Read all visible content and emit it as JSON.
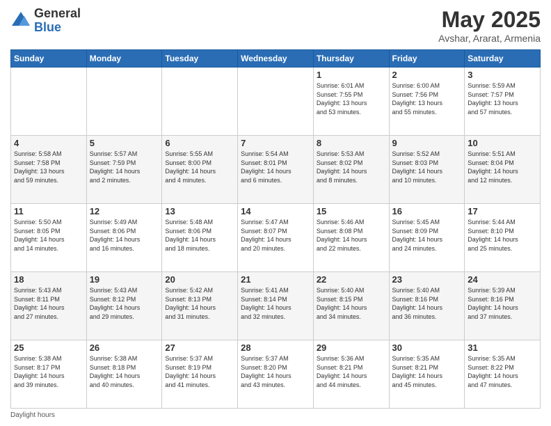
{
  "logo": {
    "general": "General",
    "blue": "Blue"
  },
  "title": "May 2025",
  "location": "Avshar, Ararat, Armenia",
  "days_of_week": [
    "Sunday",
    "Monday",
    "Tuesday",
    "Wednesday",
    "Thursday",
    "Friday",
    "Saturday"
  ],
  "weeks": [
    [
      {
        "day": "",
        "info": ""
      },
      {
        "day": "",
        "info": ""
      },
      {
        "day": "",
        "info": ""
      },
      {
        "day": "",
        "info": ""
      },
      {
        "day": "1",
        "info": "Sunrise: 6:01 AM\nSunset: 7:55 PM\nDaylight: 13 hours\nand 53 minutes."
      },
      {
        "day": "2",
        "info": "Sunrise: 6:00 AM\nSunset: 7:56 PM\nDaylight: 13 hours\nand 55 minutes."
      },
      {
        "day": "3",
        "info": "Sunrise: 5:59 AM\nSunset: 7:57 PM\nDaylight: 13 hours\nand 57 minutes."
      }
    ],
    [
      {
        "day": "4",
        "info": "Sunrise: 5:58 AM\nSunset: 7:58 PM\nDaylight: 13 hours\nand 59 minutes."
      },
      {
        "day": "5",
        "info": "Sunrise: 5:57 AM\nSunset: 7:59 PM\nDaylight: 14 hours\nand 2 minutes."
      },
      {
        "day": "6",
        "info": "Sunrise: 5:55 AM\nSunset: 8:00 PM\nDaylight: 14 hours\nand 4 minutes."
      },
      {
        "day": "7",
        "info": "Sunrise: 5:54 AM\nSunset: 8:01 PM\nDaylight: 14 hours\nand 6 minutes."
      },
      {
        "day": "8",
        "info": "Sunrise: 5:53 AM\nSunset: 8:02 PM\nDaylight: 14 hours\nand 8 minutes."
      },
      {
        "day": "9",
        "info": "Sunrise: 5:52 AM\nSunset: 8:03 PM\nDaylight: 14 hours\nand 10 minutes."
      },
      {
        "day": "10",
        "info": "Sunrise: 5:51 AM\nSunset: 8:04 PM\nDaylight: 14 hours\nand 12 minutes."
      }
    ],
    [
      {
        "day": "11",
        "info": "Sunrise: 5:50 AM\nSunset: 8:05 PM\nDaylight: 14 hours\nand 14 minutes."
      },
      {
        "day": "12",
        "info": "Sunrise: 5:49 AM\nSunset: 8:06 PM\nDaylight: 14 hours\nand 16 minutes."
      },
      {
        "day": "13",
        "info": "Sunrise: 5:48 AM\nSunset: 8:06 PM\nDaylight: 14 hours\nand 18 minutes."
      },
      {
        "day": "14",
        "info": "Sunrise: 5:47 AM\nSunset: 8:07 PM\nDaylight: 14 hours\nand 20 minutes."
      },
      {
        "day": "15",
        "info": "Sunrise: 5:46 AM\nSunset: 8:08 PM\nDaylight: 14 hours\nand 22 minutes."
      },
      {
        "day": "16",
        "info": "Sunrise: 5:45 AM\nSunset: 8:09 PM\nDaylight: 14 hours\nand 24 minutes."
      },
      {
        "day": "17",
        "info": "Sunrise: 5:44 AM\nSunset: 8:10 PM\nDaylight: 14 hours\nand 25 minutes."
      }
    ],
    [
      {
        "day": "18",
        "info": "Sunrise: 5:43 AM\nSunset: 8:11 PM\nDaylight: 14 hours\nand 27 minutes."
      },
      {
        "day": "19",
        "info": "Sunrise: 5:43 AM\nSunset: 8:12 PM\nDaylight: 14 hours\nand 29 minutes."
      },
      {
        "day": "20",
        "info": "Sunrise: 5:42 AM\nSunset: 8:13 PM\nDaylight: 14 hours\nand 31 minutes."
      },
      {
        "day": "21",
        "info": "Sunrise: 5:41 AM\nSunset: 8:14 PM\nDaylight: 14 hours\nand 32 minutes."
      },
      {
        "day": "22",
        "info": "Sunrise: 5:40 AM\nSunset: 8:15 PM\nDaylight: 14 hours\nand 34 minutes."
      },
      {
        "day": "23",
        "info": "Sunrise: 5:40 AM\nSunset: 8:16 PM\nDaylight: 14 hours\nand 36 minutes."
      },
      {
        "day": "24",
        "info": "Sunrise: 5:39 AM\nSunset: 8:16 PM\nDaylight: 14 hours\nand 37 minutes."
      }
    ],
    [
      {
        "day": "25",
        "info": "Sunrise: 5:38 AM\nSunset: 8:17 PM\nDaylight: 14 hours\nand 39 minutes."
      },
      {
        "day": "26",
        "info": "Sunrise: 5:38 AM\nSunset: 8:18 PM\nDaylight: 14 hours\nand 40 minutes."
      },
      {
        "day": "27",
        "info": "Sunrise: 5:37 AM\nSunset: 8:19 PM\nDaylight: 14 hours\nand 41 minutes."
      },
      {
        "day": "28",
        "info": "Sunrise: 5:37 AM\nSunset: 8:20 PM\nDaylight: 14 hours\nand 43 minutes."
      },
      {
        "day": "29",
        "info": "Sunrise: 5:36 AM\nSunset: 8:21 PM\nDaylight: 14 hours\nand 44 minutes."
      },
      {
        "day": "30",
        "info": "Sunrise: 5:35 AM\nSunset: 8:21 PM\nDaylight: 14 hours\nand 45 minutes."
      },
      {
        "day": "31",
        "info": "Sunrise: 5:35 AM\nSunset: 8:22 PM\nDaylight: 14 hours\nand 47 minutes."
      }
    ]
  ],
  "footer": "Daylight hours"
}
